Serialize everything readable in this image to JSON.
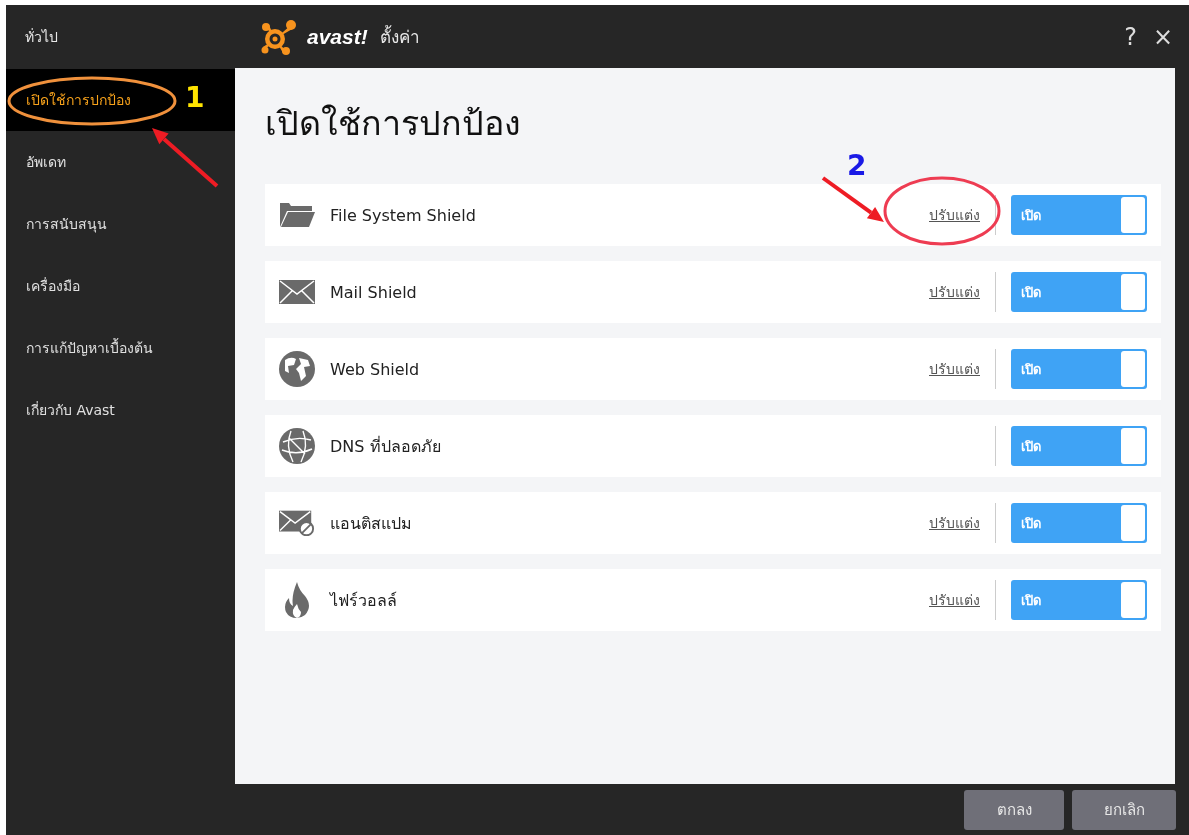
{
  "window": {
    "title": "ตั้งค่า",
    "logo": "avast!",
    "buttons": [
      "?",
      "×"
    ]
  },
  "sidebar": {
    "header": "ทั่วไป",
    "items": [
      {
        "label": "เปิดใช้การปกป้อง",
        "selected": true
      },
      {
        "label": "อัพเดท",
        "selected": false
      },
      {
        "label": "การสนับสนุน",
        "selected": false
      },
      {
        "label": "เครื่องมือ",
        "selected": false
      },
      {
        "label": "การแก้ปัญหาเบื้องต้น",
        "selected": false
      },
      {
        "label": "เกี่ยวกับ Avast",
        "selected": false
      }
    ]
  },
  "heading": "เปิดใช้การปกป้อง",
  "shields": [
    {
      "kind": "folder",
      "name": "File System Shield",
      "customize": "ปรับแต่ง",
      "toggle": {
        "label": "เปิด",
        "on": true
      }
    },
    {
      "kind": "mail",
      "name": "Mail Shield",
      "customize": "ปรับแต่ง",
      "toggle": {
        "label": "เปิด",
        "on": true
      }
    },
    {
      "kind": "globe",
      "name": "Web Shield",
      "customize": "ปรับแต่ง",
      "toggle": {
        "label": "เปิด",
        "on": true
      }
    },
    {
      "kind": "network",
      "name": "DNS ที่ปลอดภัย",
      "toggle": {
        "label": "เปิด",
        "on": true
      }
    },
    {
      "kind": "spam",
      "name": "แอนติสแปม",
      "customize": "ปรับแต่ง",
      "toggle": {
        "label": "เปิด",
        "on": true
      }
    },
    {
      "kind": "flame",
      "name": "ไฟร์วอลล์",
      "customize": "ปรับแต่ง",
      "toggle": {
        "label": "เปิด",
        "on": true
      }
    }
  ],
  "footer": {
    "buttons": [
      "ตกลง",
      "ยกเลิก"
    ]
  },
  "annotations": [
    {
      "label": "1"
    },
    {
      "label": "2"
    }
  ]
}
